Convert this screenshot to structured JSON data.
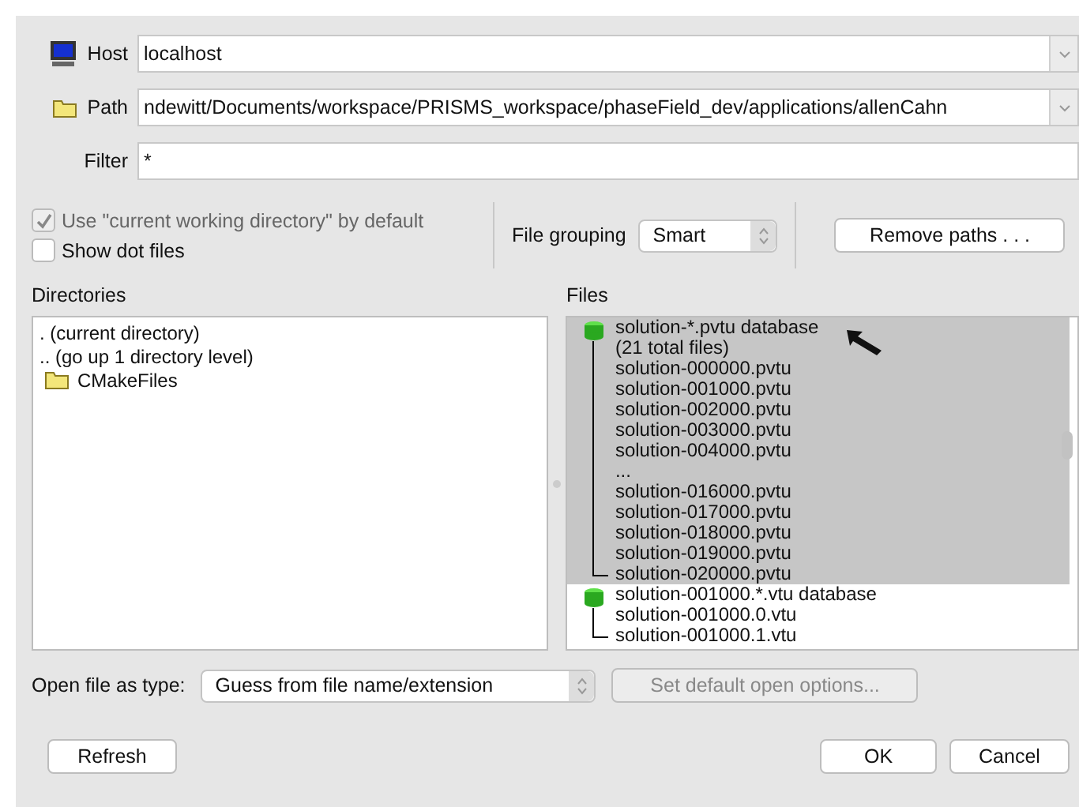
{
  "host": {
    "label": "Host",
    "value": "localhost"
  },
  "path": {
    "label": "Path",
    "value": "ndewitt/Documents/workspace/PRISMS_workspace/phaseField_dev/applications/allenCahn"
  },
  "filter": {
    "label": "Filter",
    "value": "*"
  },
  "options": [
    {
      "label": "Use \"current working directory\" by default",
      "checked": true,
      "disabled": true
    },
    {
      "label": "Show dot files",
      "checked": false,
      "disabled": false
    }
  ],
  "file_grouping": {
    "label": "File grouping",
    "value": "Smart"
  },
  "remove_paths": "Remove paths . . .",
  "directories": {
    "title": "Directories",
    "items": [
      {
        "label": ". (current directory)",
        "kind": "special"
      },
      {
        "label": ".. (go up 1 directory level)",
        "kind": "special"
      },
      {
        "label": "CMakeFiles",
        "kind": "folder"
      }
    ]
  },
  "files": {
    "title": "Files",
    "groups": [
      {
        "label": "solution-*.pvtu database",
        "selected": true,
        "children": [
          "(21 total files)",
          "solution-000000.pvtu",
          "solution-001000.pvtu",
          "solution-002000.pvtu",
          "solution-003000.pvtu",
          "solution-004000.pvtu",
          "...",
          "solution-016000.pvtu",
          "solution-017000.pvtu",
          "solution-018000.pvtu",
          "solution-019000.pvtu",
          "solution-020000.pvtu"
        ]
      },
      {
        "label": "solution-001000.*.vtu database",
        "selected": false,
        "children": [
          "solution-001000.0.vtu",
          "solution-001000.1.vtu"
        ]
      }
    ]
  },
  "open_type": {
    "label": "Open file as type:",
    "value": "Guess from file name/extension"
  },
  "default_options": {
    "label": "Set default open options...",
    "disabled": true
  },
  "buttons": [
    {
      "label": "Refresh",
      "kind": "left"
    },
    {
      "label": "OK",
      "kind": "right"
    },
    {
      "label": "Cancel",
      "kind": "right"
    }
  ]
}
